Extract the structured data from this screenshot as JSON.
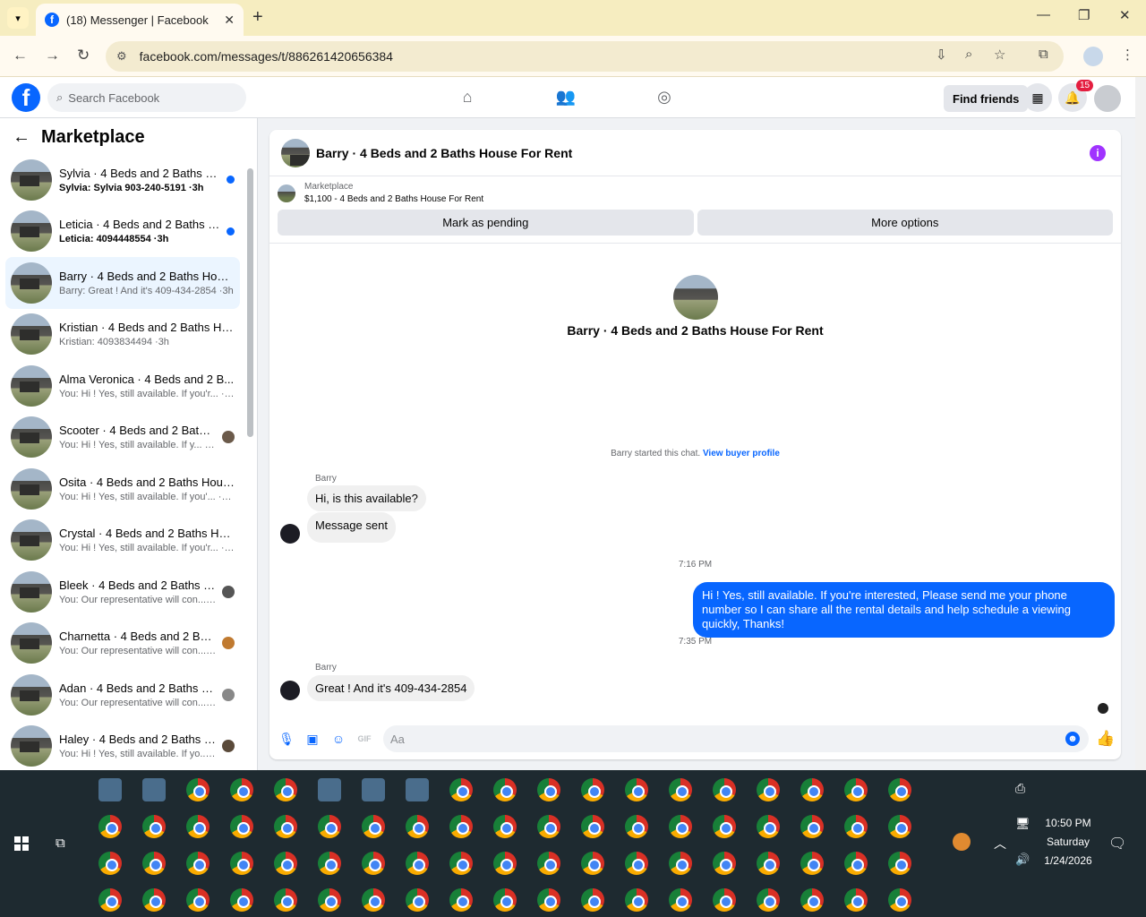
{
  "browser": {
    "tab_title": "(18) Messenger | Facebook",
    "url": "facebook.com/messages/t/886261420656384",
    "new_tab_glyph": "+",
    "close_glyph": "✕"
  },
  "fb_header": {
    "search_placeholder": "Search Facebook",
    "find_friends": "Find friends",
    "notifications_count": "15"
  },
  "sidebar": {
    "title": "Marketplace",
    "conversations": [
      {
        "name": "Sylvia · 4 Beds and 2 Baths Ho...",
        "snippet": "Sylvia: Sylvia 903-240-5191 ·3h",
        "unread": true
      },
      {
        "name": "Leticia · 4 Beds and 2 Baths H...",
        "snippet": "Leticia: 4094448554 ·3h",
        "unread": true
      },
      {
        "name": "Barry · 4 Beds and 2 Baths Hous...",
        "snippet": "Barry: Great ! And it's 409-434-2854 ·3h",
        "active": true
      },
      {
        "name": "Kristian · 4 Beds and 2 Baths Ho...",
        "snippet": "Kristian: 4093834494 ·3h"
      },
      {
        "name": "Alma Veronica · 4 Beds and 2 B...",
        "snippet": "You: Hi ! Yes, still available. If you'r... ·3h"
      },
      {
        "name": "Scooter · 4 Beds and 2 Baths ...",
        "snippet": "You: Hi ! Yes, still available. If y... ·23h"
      },
      {
        "name": "Osita · 4 Beds and 2 Baths Hous...",
        "snippet": "You: Hi ! Yes, still available. If you'... ·23h"
      },
      {
        "name": "Crystal · 4 Beds and 2 Baths Ho...",
        "snippet": "You: Hi ! Yes, still available. If you'r... ·1d"
      },
      {
        "name": "Bleek · 4 Beds and 2 Baths H...",
        "snippet": "You: Our representative will con... ·1d"
      },
      {
        "name": "Charnetta · 4 Beds and 2 Bat...",
        "snippet": "You: Our representative will con... ·1d"
      },
      {
        "name": "Adan · 4 Beds and 2 Baths Ho...",
        "snippet": "You: Our representative will con... ·1d"
      },
      {
        "name": "Haley · 4 Beds and 2 Baths H...",
        "snippet": "You: Hi ! Yes, still available. If yo... ·1d"
      }
    ]
  },
  "chat": {
    "title": "Barry · 4 Beds and 2 Baths House For Rent",
    "marketplace_label": "Marketplace",
    "listing": "$1,100 - 4 Beds and 2 Baths House For Rent",
    "mark_pending": "Mark as pending",
    "more_options": "More options",
    "hero_title": "Barry · 4 Beds and 2 Baths House For Rent",
    "started_text": "Barry started this chat.",
    "view_profile": "View buyer profile",
    "messages": {
      "sender1": "Barry",
      "m1": "Hi, is this available?",
      "m2": "Message sent",
      "time1": "7:16 PM",
      "m3": "Hi ! Yes, still available. If you're interested, Please send me your phone number so I can share all the rental details and help schedule a viewing quickly, Thanks!",
      "time2": "7:35 PM",
      "sender2": "Barry",
      "m4": "Great ! And it's 409-434-2854"
    },
    "composer_placeholder": "Aa"
  },
  "taskbar": {
    "time": "10:50 PM",
    "day": "Saturday",
    "date": "1/24/2026"
  }
}
